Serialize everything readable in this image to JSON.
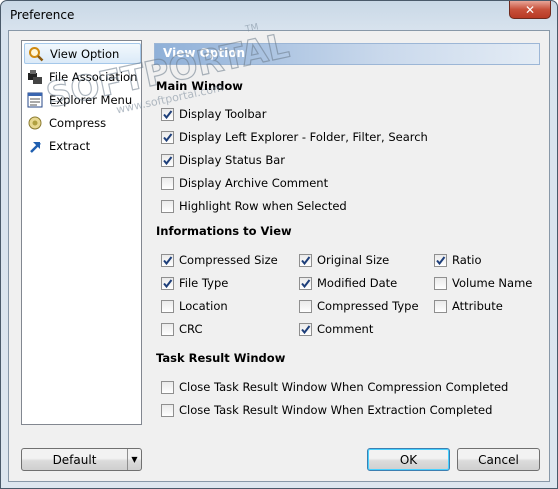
{
  "window": {
    "title": "Preference",
    "close_glyph": "✕"
  },
  "nav": {
    "items": [
      {
        "label": "View Option",
        "icon": "magnifier-icon",
        "selected": true
      },
      {
        "label": "File Association",
        "icon": "file-association-icon",
        "selected": false
      },
      {
        "label": "Explorer Menu",
        "icon": "explorer-menu-icon",
        "selected": false
      },
      {
        "label": "Compress",
        "icon": "compress-icon",
        "selected": false
      },
      {
        "label": "Extract",
        "icon": "extract-arrow-icon",
        "selected": false
      }
    ]
  },
  "watermark": {
    "text": "SOFTPORTAL",
    "url": "www.softportal.com",
    "tm": "TM"
  },
  "panel": {
    "header": "View Option",
    "main_window": {
      "title": "Main Window",
      "options": [
        {
          "label": "Display Toolbar",
          "checked": true
        },
        {
          "label": "Display Left Explorer - Folder, Filter, Search",
          "checked": true
        },
        {
          "label": "Display Status Bar",
          "checked": true
        },
        {
          "label": "Display Archive Comment",
          "checked": false
        },
        {
          "label": "Highlight Row when Selected",
          "checked": false
        }
      ]
    },
    "informations": {
      "title": "Informations to View",
      "options": [
        {
          "label": "Compressed Size",
          "checked": true
        },
        {
          "label": "Original Size",
          "checked": true
        },
        {
          "label": "Ratio",
          "checked": true
        },
        {
          "label": "File Type",
          "checked": true
        },
        {
          "label": "Modified Date",
          "checked": true
        },
        {
          "label": "Volume Name",
          "checked": false
        },
        {
          "label": "Location",
          "checked": false
        },
        {
          "label": "Compressed Type",
          "checked": false
        },
        {
          "label": "Attribute",
          "checked": false
        },
        {
          "label": "CRC",
          "checked": false
        },
        {
          "label": "Comment",
          "checked": true
        }
      ]
    },
    "task_result": {
      "title": "Task Result Window",
      "options": [
        {
          "label": "Close Task Result Window When Compression Completed",
          "checked": false
        },
        {
          "label": "Close Task Result Window When Extraction Completed",
          "checked": false
        }
      ]
    }
  },
  "buttons": {
    "default_label": "Default",
    "dropdown_glyph": "▼",
    "ok_label": "OK",
    "cancel_label": "Cancel"
  }
}
